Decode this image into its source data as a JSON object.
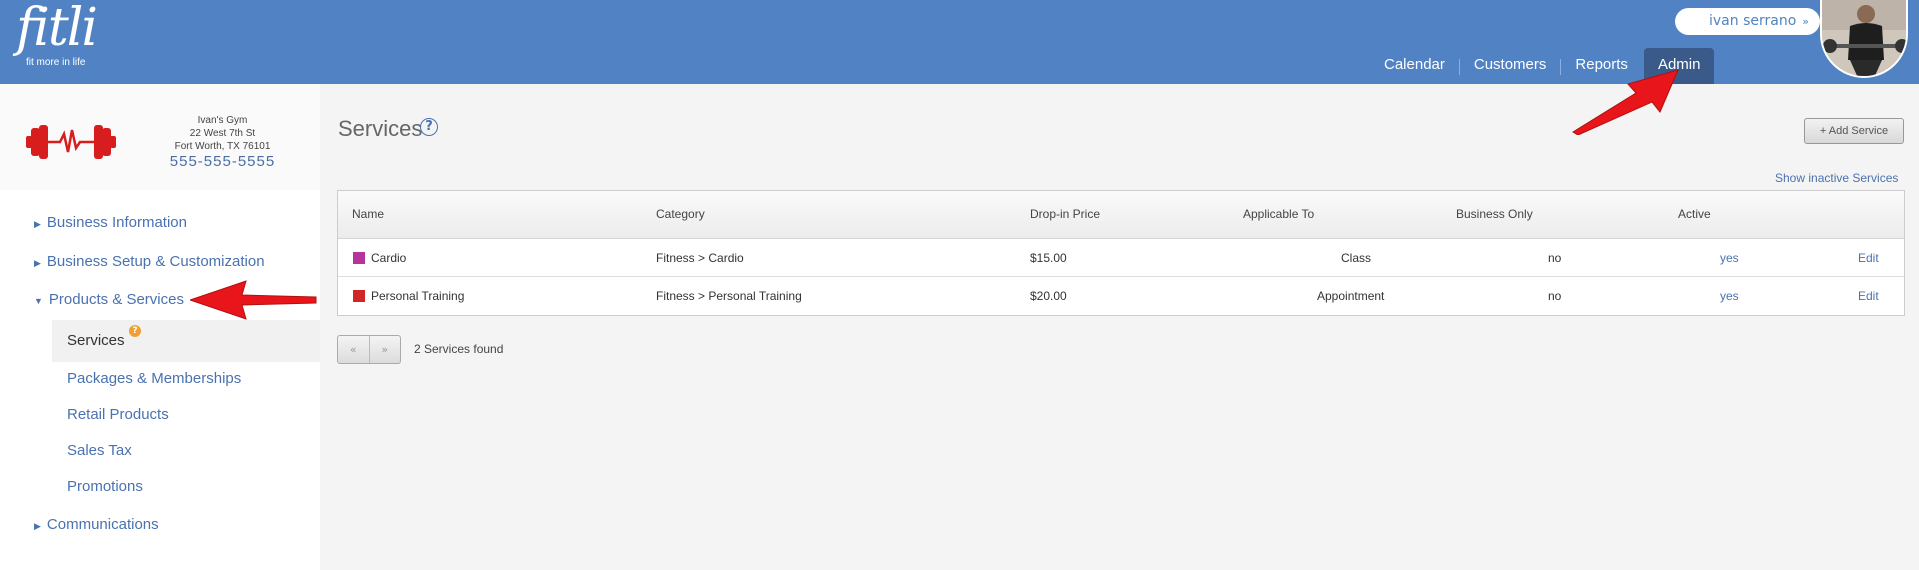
{
  "header": {
    "logo_word": "fitli",
    "logo_tagline": "fit more in life",
    "user_name": "ivan serrano",
    "user_chevron": "»",
    "nav": [
      {
        "label": "Calendar"
      },
      {
        "label": "Customers"
      },
      {
        "label": "Reports"
      },
      {
        "label": "Admin",
        "active": true
      }
    ]
  },
  "business": {
    "name": "Ivan's Gym",
    "address1": "22 West 7th St",
    "address2": "Fort Worth, TX 76101",
    "phone": "555-555-5555"
  },
  "sidebar": {
    "items": [
      {
        "label": "Business Information",
        "expanded": false
      },
      {
        "label": "Business Setup & Customization",
        "expanded": false
      },
      {
        "label": "Products & Services",
        "expanded": true
      },
      {
        "label": "Communications",
        "expanded": false
      }
    ],
    "subitems": [
      {
        "label": "Services",
        "active": true,
        "badge": "?"
      },
      {
        "label": "Packages & Memberships"
      },
      {
        "label": "Retail Products"
      },
      {
        "label": "Sales Tax"
      },
      {
        "label": "Promotions"
      }
    ]
  },
  "main": {
    "title": "Services",
    "help_glyph": "?",
    "add_button": "+ Add Service",
    "show_inactive": "Show inactive Services",
    "table": {
      "headers": [
        "Name",
        "Category",
        "Drop-in Price",
        "Applicable To",
        "Business Only",
        "Active"
      ],
      "rows": [
        {
          "name": "Cardio",
          "color": "#b5339a",
          "category": "Fitness > Cardio",
          "price": "$15.00",
          "applicable": "Class",
          "business_only": "no",
          "active": "yes",
          "action": "Edit"
        },
        {
          "name": "Personal Training",
          "color": "#d02626",
          "category": "Fitness > Personal Training",
          "price": "$20.00",
          "applicable": "Appointment",
          "business_only": "no",
          "active": "yes",
          "action": "Edit"
        }
      ]
    },
    "pager": {
      "prev": "«",
      "next": "»"
    },
    "found_text": "2 Services found"
  },
  "colors": {
    "header_bg": "#5183c4",
    "active_nav": "#3a5a8a",
    "link": "#4a72b0",
    "annotation_arrow": "#e8151b"
  }
}
